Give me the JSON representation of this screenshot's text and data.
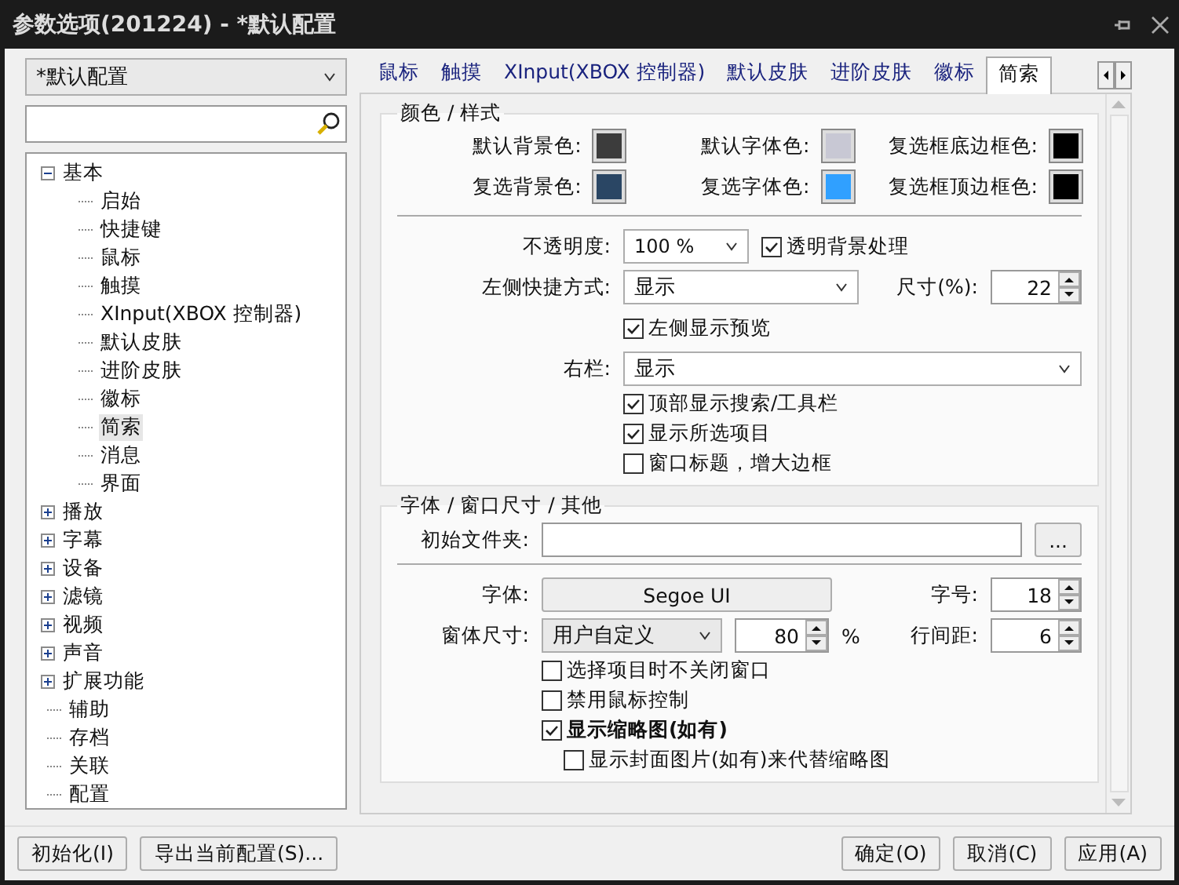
{
  "window": {
    "title": "参数选项(201224) - *默认配置"
  },
  "profile_select": {
    "value": "*默认配置"
  },
  "tree": [
    {
      "label": "基本",
      "kind": "folder",
      "expanded": true,
      "selected": false,
      "children": [
        {
          "label": "启始",
          "selected": false
        },
        {
          "label": "快捷键",
          "selected": false
        },
        {
          "label": "鼠标",
          "selected": false
        },
        {
          "label": "触摸",
          "selected": false
        },
        {
          "label": "XInput(XBOX 控制器)",
          "selected": false
        },
        {
          "label": "默认皮肤",
          "selected": false
        },
        {
          "label": "进阶皮肤",
          "selected": false
        },
        {
          "label": "徽标",
          "selected": false
        },
        {
          "label": "简索",
          "selected": true
        },
        {
          "label": "消息",
          "selected": false
        },
        {
          "label": "界面",
          "selected": false
        }
      ]
    },
    {
      "label": "播放",
      "kind": "folder",
      "expanded": false,
      "selected": false
    },
    {
      "label": "字幕",
      "kind": "folder",
      "expanded": false,
      "selected": false
    },
    {
      "label": "设备",
      "kind": "folder",
      "expanded": false,
      "selected": false
    },
    {
      "label": "滤镜",
      "kind": "folder",
      "expanded": false,
      "selected": false
    },
    {
      "label": "视频",
      "kind": "folder",
      "expanded": false,
      "selected": false
    },
    {
      "label": "声音",
      "kind": "folder",
      "expanded": false,
      "selected": false
    },
    {
      "label": "扩展功能",
      "kind": "folder",
      "expanded": false,
      "selected": false
    },
    {
      "label": "辅助",
      "kind": "leaf",
      "selected": false
    },
    {
      "label": "存档",
      "kind": "leaf",
      "selected": false
    },
    {
      "label": "关联",
      "kind": "leaf",
      "selected": false
    },
    {
      "label": "配置",
      "kind": "leaf",
      "selected": false
    }
  ],
  "tabs": [
    {
      "label": "鼠标",
      "selected": false
    },
    {
      "label": "触摸",
      "selected": false
    },
    {
      "label": "XInput(XBOX 控制器)",
      "selected": false
    },
    {
      "label": "默认皮肤",
      "selected": false
    },
    {
      "label": "进阶皮肤",
      "selected": false
    },
    {
      "label": "徽标",
      "selected": false
    },
    {
      "label": "简索",
      "selected": true
    }
  ],
  "color_style": {
    "title": "颜色 / 样式",
    "swatches": [
      {
        "label": "默认背景色:",
        "color": "#3c3c3c"
      },
      {
        "label": "默认字体色:",
        "color": "#c8c8d4"
      },
      {
        "label": "复选框底边框色:",
        "color": "#000000"
      },
      {
        "label": "复选背景色:",
        "color": "#2a4664"
      },
      {
        "label": "复选字体色:",
        "color": "#30a0ff"
      },
      {
        "label": "复选框顶边框色:",
        "color": "#000000"
      }
    ],
    "opacity": {
      "label": "不透明度:",
      "value": "100 %"
    },
    "transparent_bg": {
      "label": "透明背景处理",
      "checked": true
    },
    "left_shortcut": {
      "label": "左侧快捷方式:",
      "value": "显示"
    },
    "size": {
      "label": "尺寸(%):",
      "value": "22"
    },
    "left_preview": {
      "label": "左侧显示预览",
      "checked": true
    },
    "right_bar": {
      "label": "右栏:",
      "value": "显示"
    },
    "checkboxes": [
      {
        "label": "顶部显示搜索/工具栏",
        "checked": true
      },
      {
        "label": "显示所选项目",
        "checked": true
      },
      {
        "label": "窗口标题，增大边框",
        "checked": false
      }
    ]
  },
  "font_window": {
    "title": "字体 / 窗口尺寸 / 其他",
    "initial_folder": {
      "label": "初始文件夹:",
      "browse": "..."
    },
    "font": {
      "label": "字体:",
      "value": "Segoe UI"
    },
    "font_size": {
      "label": "字号:",
      "value": "18"
    },
    "window_size": {
      "label": "窗体尺寸:",
      "value": "用户自定义",
      "percent": "80",
      "unit": "%"
    },
    "line_spacing": {
      "label": "行间距:",
      "value": "6"
    },
    "checkboxes": [
      {
        "label": "选择项目时不关闭窗口",
        "checked": false,
        "bold": false
      },
      {
        "label": "禁用鼠标控制",
        "checked": false,
        "bold": false
      },
      {
        "label": "显示缩略图(如有)",
        "checked": true,
        "bold": true,
        "children": [
          {
            "label": "显示封面图片(如有)来代替缩略图",
            "checked": false,
            "bold": false
          }
        ]
      }
    ]
  },
  "footer": {
    "left_buttons": [
      "初始化(I)",
      "导出当前配置(S)..."
    ],
    "right_buttons": [
      "确定(O)",
      "取消(C)",
      "应用(A)"
    ]
  }
}
